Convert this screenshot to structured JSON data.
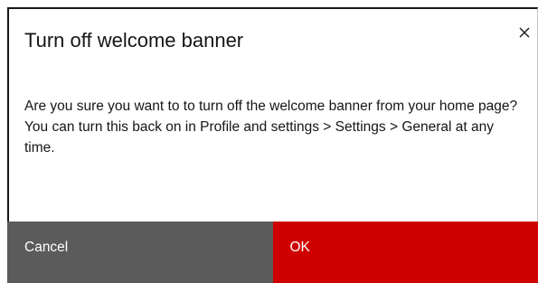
{
  "dialog": {
    "title": "Turn off welcome banner",
    "message": "Are you sure you want to to turn off the welcome banner from your home page? You can turn this back on in Profile and settings > Settings > General at any time.",
    "close_icon": "close-icon"
  },
  "footer": {
    "cancel_label": "Cancel",
    "ok_label": "OK"
  },
  "colors": {
    "cancel_bg": "#5b5b5b",
    "ok_bg": "#cf0000",
    "text": "#161616"
  }
}
